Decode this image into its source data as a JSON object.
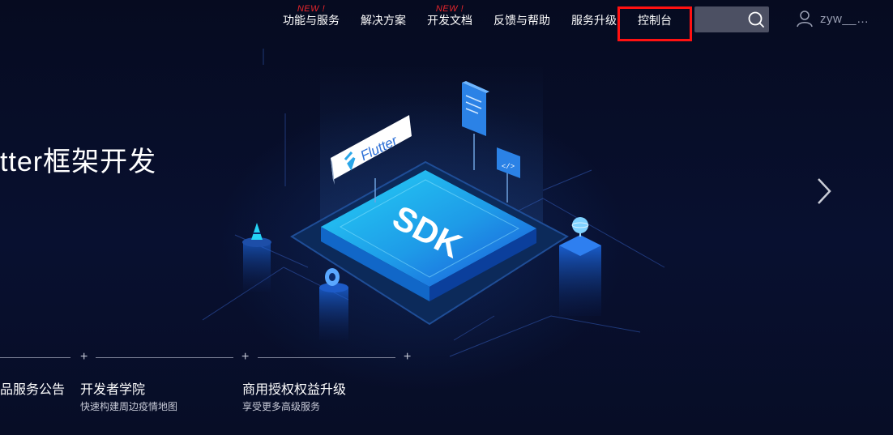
{
  "nav": {
    "items": [
      {
        "label": "功能与服务",
        "badge": "NEW !"
      },
      {
        "label": "解决方案",
        "badge": ""
      },
      {
        "label": "开发文档",
        "badge": "NEW !"
      },
      {
        "label": "反馈与帮助",
        "badge": ""
      },
      {
        "label": "服务升级",
        "badge": ""
      },
      {
        "label": "控制台",
        "badge": ""
      }
    ],
    "search": {
      "value": "",
      "placeholder": ""
    },
    "user": {
      "name": "zyw__…"
    }
  },
  "hero": {
    "title": "tter框架开发",
    "illustration": {
      "chip_label": "SDK",
      "tag_label": "Flutter",
      "code_label": "</>"
    }
  },
  "cards": [
    {
      "title": "品服务公告",
      "subtitle": ""
    },
    {
      "title": "开发者学院",
      "subtitle": "快速构建周边疫情地图"
    },
    {
      "title": "商用授权权益升级",
      "subtitle": "享受更多高级服务"
    }
  ],
  "plus_symbol": "+",
  "colors": {
    "background": "#070d24",
    "new_badge": "#e8262c",
    "highlight": "#ff1111",
    "search_bg": "#4c5063",
    "chip_top": "#1e9be8"
  }
}
